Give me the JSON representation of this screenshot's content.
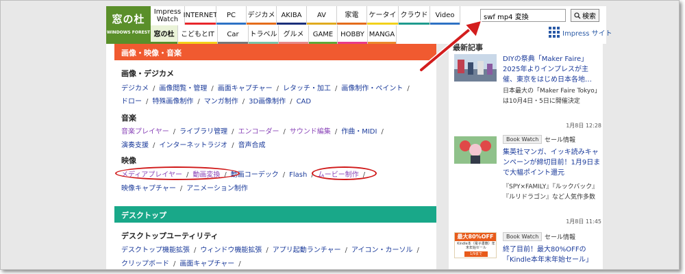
{
  "logo": {
    "main": "窓の杜",
    "sub": "WINDOWS FOREST"
  },
  "nav_top": [
    {
      "label": "Impress Watch",
      "color": "#ffffff"
    },
    {
      "label": "INTERNET",
      "color": "#e8262b"
    },
    {
      "label": "PC",
      "color": "#2d72c4"
    },
    {
      "label": "デジカメ",
      "color": "#e46c1b"
    },
    {
      "label": "AKIBA",
      "color": "#1b2f7a"
    },
    {
      "label": "AV",
      "color": "#e0ab1f"
    },
    {
      "label": "家電",
      "color": "#e46c1b"
    },
    {
      "label": "ケータイ",
      "color": "#f2d11a"
    },
    {
      "label": "クラウド",
      "color": "#1f9b8e"
    },
    {
      "label": "Video",
      "color": "#2d72c4"
    }
  ],
  "nav_bottom": [
    {
      "label": "窓の杜",
      "color": "#5a8f2a"
    },
    {
      "label": "こどもとIT",
      "color": "#f2d11a"
    },
    {
      "label": "Car",
      "color": "#777777"
    },
    {
      "label": "トラベル",
      "color": "#7ac4a6"
    },
    {
      "label": "グルメ",
      "color": "#e48a8a"
    },
    {
      "label": "GAME",
      "color": "#5fa83a"
    },
    {
      "label": "HOBBY",
      "color": "#e83b8a"
    },
    {
      "label": "MANGA",
      "color": "#eb8a2c"
    }
  ],
  "search": {
    "value": "swf mp4 変換",
    "button": "検索"
  },
  "impress_site": "Impress サイト",
  "sections": {
    "image": {
      "header": "画像・映像・音楽",
      "header_color": "#f05a30",
      "sub1": "画像・デジカメ",
      "row1": [
        "デジカメ",
        "画像閲覧・管理",
        "画面キャプチャー",
        "レタッチ・加工",
        "画像制作・ペイント"
      ],
      "row2": [
        "ドロー",
        "特殊画像制作",
        "マンガ制作",
        "3D画像制作",
        "CAD"
      ],
      "sub2": "音楽",
      "row3": [
        "音楽プレイヤー",
        "ライブラリ管理",
        "エンコーダー",
        "サウンド編集",
        "作曲・MIDI"
      ],
      "row4": [
        "演奏支援",
        "インターネットラジオ",
        "音声合成"
      ],
      "sub3": "映像",
      "row5": [
        "メディアプレイヤー",
        "動画変換",
        "動画コーデック",
        "Flash",
        "ムービー制作"
      ],
      "row6": [
        "映像キャプチャー",
        "アニメーション制作"
      ]
    },
    "desktop": {
      "header": "デスクトップ",
      "header_color": "#19a889",
      "sub1": "デスクトップユーティリティ",
      "row1": [
        "デスクトップ機能拡張",
        "ウィンドウ機能拡張",
        "アプリ起動ランチャー",
        "アイコン・カーソル"
      ],
      "row2": [
        "クリップボード",
        "画面キャプチャー"
      ]
    }
  },
  "sidebar": {
    "title": "最新記事",
    "articles": [
      {
        "title": "DIYの祭典「Maker Faire」2025年よりインプレスが主催、東京をはじめ日本各地…",
        "desc": "日本最大の「Maker Faire Tokyo」は10月4日・5日に開催決定",
        "time": "1月8日 12:28"
      },
      {
        "badge": "Book Watch",
        "category": "セール情報",
        "title": "集英社マンガ、イッキ読みキャンペーンが締切目前！1月9日まで大幅ポイント還元",
        "desc": "『SPY×FAMILY』『ルックバック』『ルリドラゴン』など人気作多数",
        "time": "1月8日 11:45"
      },
      {
        "badge": "Book Watch",
        "category": "セール情報",
        "thumb_text1": "最大80%OFF",
        "thumb_text2": "Kindle本（電子書籍）年末年始セール",
        "thumb_text3": "1/9まで",
        "title": "終了目前！最大80%OFFの「Kindle本年末年始セール」"
      }
    ]
  }
}
